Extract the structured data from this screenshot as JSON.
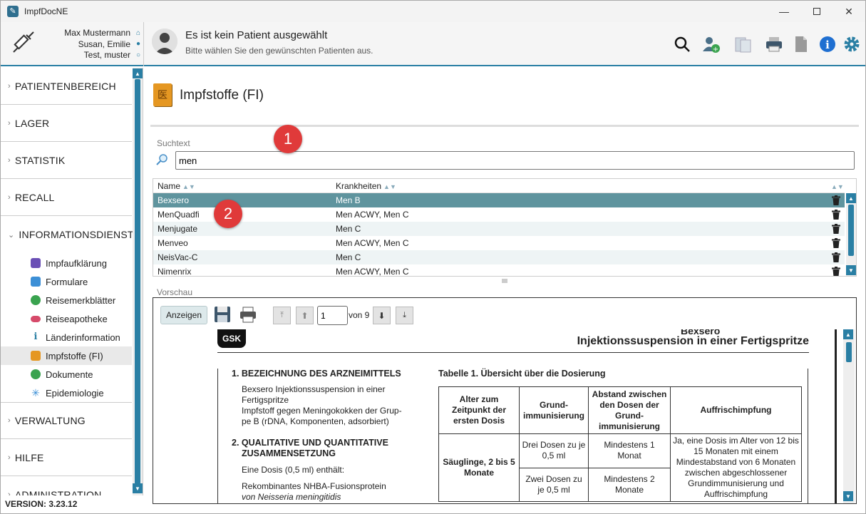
{
  "window": {
    "title": "ImpfDocNE",
    "minimize_icon": "minimize-icon",
    "maximize_icon": "maximize-icon",
    "close_icon": "close-icon"
  },
  "header": {
    "users": [
      "Max Mustermann",
      "Susan, Emilie",
      "Test, muster"
    ],
    "patient_title": "Es ist kein Patient ausgewählt",
    "patient_subtitle": "Bitte wählen Sie den gewünschten Patienten aus.",
    "toolbar_icons": [
      "search-icon",
      "add-user-icon",
      "clipboard-icon",
      "printer-icon",
      "document-icon",
      "info-icon",
      "gear-icon"
    ]
  },
  "sidebar": {
    "sections": [
      {
        "label": "PATIENTENBEREICH"
      },
      {
        "label": "LAGER"
      },
      {
        "label": "STATISTIK"
      },
      {
        "label": "RECALL"
      },
      {
        "label": "INFORMATIONSDIENST"
      }
    ],
    "subitems": [
      {
        "label": "Impfaufklärung",
        "icon": "book-icon",
        "color": "#6a4fb5"
      },
      {
        "label": "Formulare",
        "icon": "form-icon",
        "color": "#3c8fd6"
      },
      {
        "label": "Reisemerkblätter",
        "icon": "globe-icon",
        "color": "#3aa34f"
      },
      {
        "label": "Reiseapotheke",
        "icon": "pill-icon",
        "color": "#d64a6a"
      },
      {
        "label": "Länderinformation",
        "icon": "info-icon",
        "color": "#2a7fa4"
      },
      {
        "label": "Impfstoffe (FI)",
        "icon": "vaccine-doc-icon",
        "color": "#e59722"
      },
      {
        "label": "Dokumente",
        "icon": "globe-doc-icon",
        "color": "#3aa34f"
      },
      {
        "label": "Epidemiologie",
        "icon": "virus-icon",
        "color": "#3c8fd6"
      }
    ],
    "sections_after": [
      {
        "label": "VERWALTUNG"
      },
      {
        "label": "HILFE"
      },
      {
        "label": "ADMINISTRATION"
      }
    ],
    "version": "VERSION: 3.23.12"
  },
  "main": {
    "title": "Impfstoffe (FI)",
    "search": {
      "label": "Suchtext",
      "value": "men"
    },
    "badges": [
      "1",
      "2"
    ],
    "table": {
      "columns": [
        "Name",
        "Krankheiten"
      ],
      "rows": [
        {
          "name": "Bexsero",
          "krankheiten": "Men B",
          "selected": true
        },
        {
          "name": "MenQuadfi",
          "krankheiten": "Men ACWY, Men C"
        },
        {
          "name": "Menjugate",
          "krankheiten": "Men C"
        },
        {
          "name": "Menveo",
          "krankheiten": "Men ACWY, Men C"
        },
        {
          "name": "NeisVac-C",
          "krankheiten": "Men C"
        },
        {
          "name": "Nimenrix",
          "krankheiten": "Men ACWY, Men C"
        }
      ]
    },
    "preview": {
      "label": "Vorschau",
      "show_button": "Anzeigen",
      "page_value": "1",
      "page_of": "von 9",
      "doc": {
        "logo": "GSK",
        "title_cut": "Bexsero",
        "title": "Injektionssuspension in einer Fertigspritze",
        "s1_heading": "1. BEZEICHNUNG DES ARZNEIMITTELS",
        "s1_text": [
          "Bexsero Injektionssuspension in einer",
          "Fertigspritze",
          "Impfstoff gegen Meningokokken der Grup-",
          "pe B (rDNA, Komponenten, adsorbiert)"
        ],
        "s2_heading": [
          "2. QUALITATIVE UND QUANTITATIVE",
          "ZUSAMMENSETZUNG"
        ],
        "s2_text": "Eine Dosis (0,5 ml) enthält:",
        "s2_text2": "Rekombinantes NHBA-Fusionsprotein",
        "s2_text3": "von Neisseria meningitidis",
        "table_title": "Tabelle 1.  Übersicht über die Dosierung",
        "table_head": [
          "Alter zum Zeitpunkt der ersten Dosis",
          "Grund-immunisierung",
          "Abstand zwischen den Dosen der Grund-immunisierung",
          "Auffrischimpfung"
        ],
        "table_rowhead": "Säuglinge, 2 bis 5 Monate",
        "table_row1": [
          "Drei Dosen zu je 0,5 ml",
          "Mindestens 1 Monat"
        ],
        "table_row2": [
          "Zwei Dosen zu je 0,5 ml",
          "Mindestens 2 Monate"
        ],
        "table_booster": "Ja, eine Dosis im Alter von 12 bis 15 Monaten mit einem Mindestabstand von 6 Monaten zwischen abgeschlossener Grundimmunisierung und Auffrischimpfung"
      }
    }
  }
}
